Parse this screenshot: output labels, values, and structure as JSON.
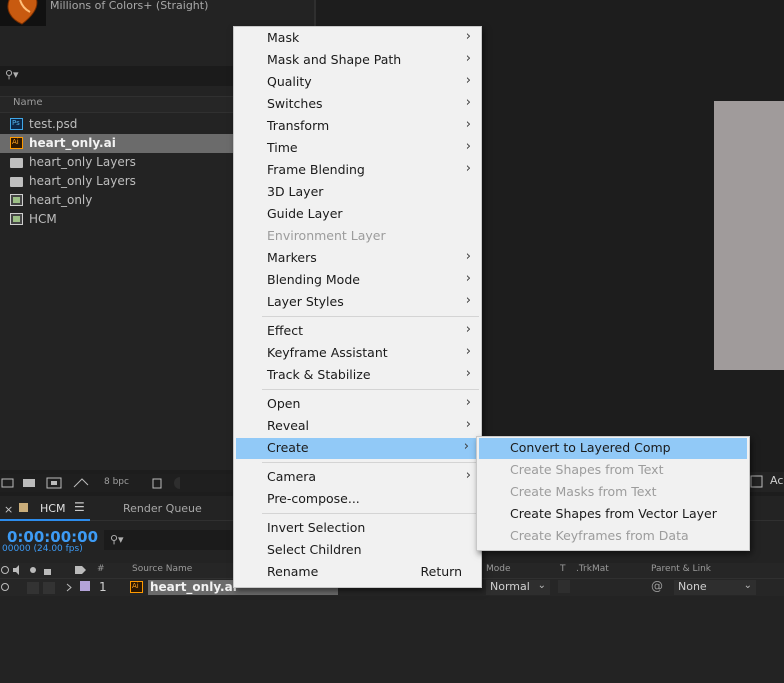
{
  "project": {
    "thumb_info": "Millions of Colors+ (Straight)",
    "col_name": "Name",
    "items": [
      {
        "label": "test.psd",
        "icon": "psd-file-icon"
      },
      {
        "label": "heart_only.ai",
        "icon": "ai-file-icon"
      },
      {
        "label": "heart_only Layers",
        "icon": "folder-icon"
      },
      {
        "label": "heart_only Layers",
        "icon": "folder-icon"
      },
      {
        "label": "heart_only",
        "icon": "composition-icon"
      },
      {
        "label": "HCM",
        "icon": "composition-icon"
      }
    ],
    "bpc": "8 bpc"
  },
  "viewer": {
    "toolbar_text": "Ac"
  },
  "timeline": {
    "tab_label": "HCM",
    "render_queue": "Render Queue",
    "timecode": "0:00:00:00",
    "timecode_sub": "00000 (24.00 fps)",
    "headers": {
      "num": "#",
      "source_name": "Source Name",
      "mode": "Mode",
      "t": "T",
      "trkmat": ".TrkMat",
      "parent": "Parent & Link"
    },
    "layer": {
      "number": "1",
      "name": "heart_only.ai",
      "mode": "Normal",
      "parent": "None"
    }
  },
  "context_menu": {
    "groups": [
      [
        {
          "label": "Mask",
          "submenu": true
        },
        {
          "label": "Mask and Shape Path",
          "submenu": true
        },
        {
          "label": "Quality",
          "submenu": true
        },
        {
          "label": "Switches",
          "submenu": true
        },
        {
          "label": "Transform",
          "submenu": true
        },
        {
          "label": "Time",
          "submenu": true
        },
        {
          "label": "Frame Blending",
          "submenu": true
        },
        {
          "label": "3D Layer",
          "submenu": false
        },
        {
          "label": "Guide Layer",
          "submenu": false
        },
        {
          "label": "Environment Layer",
          "submenu": false,
          "disabled": true
        },
        {
          "label": "Markers",
          "submenu": true
        },
        {
          "label": "Blending Mode",
          "submenu": true
        },
        {
          "label": "Layer Styles",
          "submenu": true
        }
      ],
      [
        {
          "label": "Effect",
          "submenu": true
        },
        {
          "label": "Keyframe Assistant",
          "submenu": true
        },
        {
          "label": "Track & Stabilize",
          "submenu": true
        }
      ],
      [
        {
          "label": "Open",
          "submenu": true
        },
        {
          "label": "Reveal",
          "submenu": true
        },
        {
          "label": "Create",
          "submenu": true,
          "highlight": true
        }
      ],
      [
        {
          "label": "Camera",
          "submenu": true
        },
        {
          "label": "Pre-compose...",
          "submenu": false
        }
      ],
      [
        {
          "label": "Invert Selection",
          "submenu": false
        },
        {
          "label": "Select Children",
          "submenu": false
        },
        {
          "label": "Rename",
          "submenu": false,
          "shortcut": "Return"
        }
      ]
    ]
  },
  "create_submenu": {
    "items": [
      {
        "label": "Convert to Layered Comp",
        "highlight": true
      },
      {
        "label": "Create Shapes from Text",
        "disabled": true
      },
      {
        "label": "Create Masks from Text",
        "disabled": true
      },
      {
        "label": "Create Shapes from Vector Layer"
      },
      {
        "label": "Create Keyframes from Data",
        "disabled": true
      }
    ]
  },
  "colors": {
    "menu_highlight": "#91c9f7",
    "timecode": "#3d9bf5",
    "viewer_image": "#a09b9b"
  }
}
